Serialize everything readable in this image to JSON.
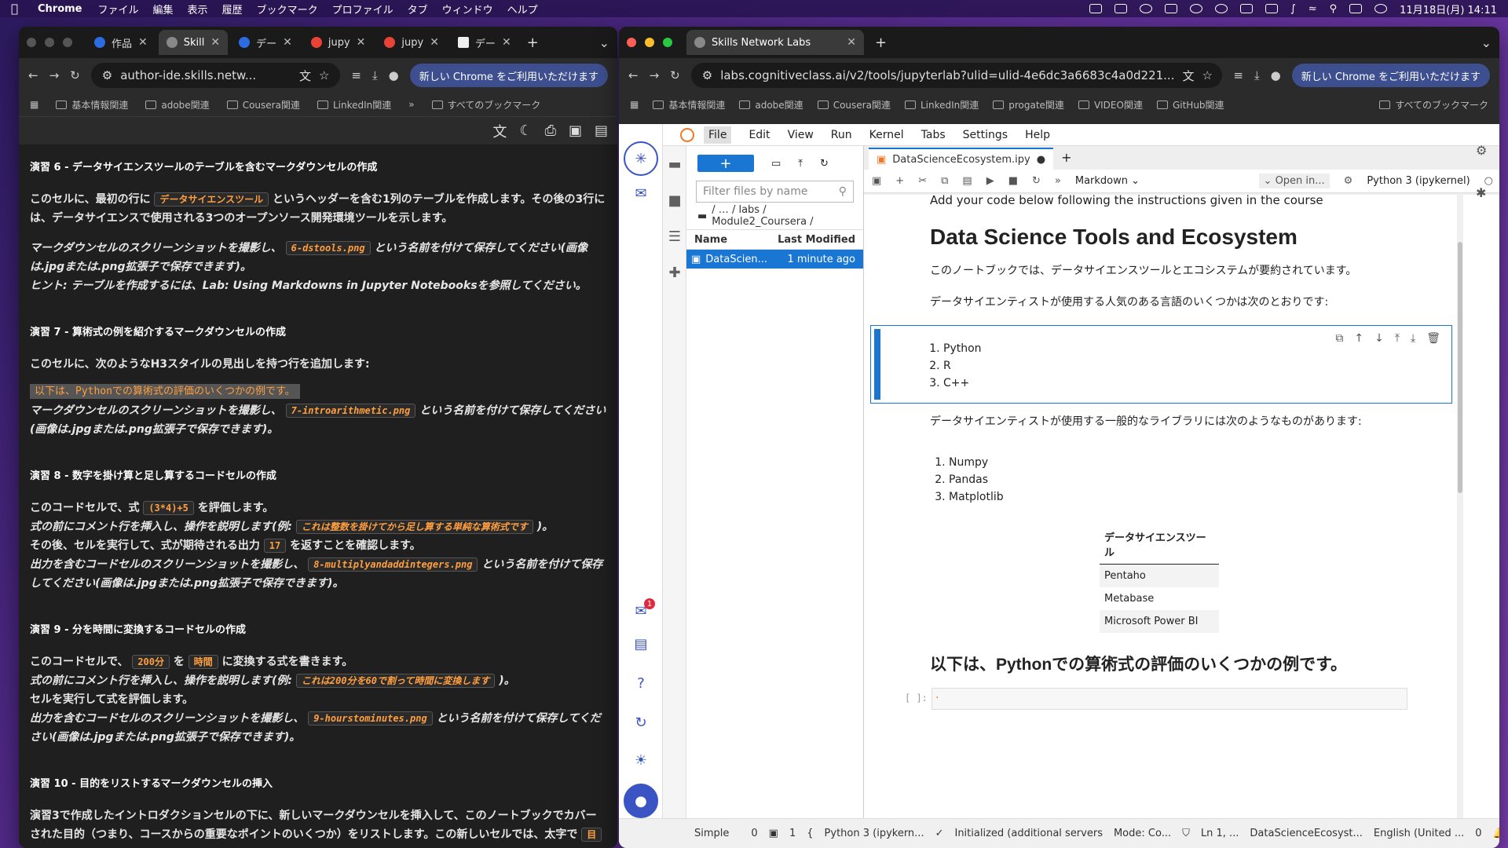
{
  "menubar": {
    "app": "Chrome",
    "items": [
      "ファイル",
      "編集",
      "表示",
      "履歴",
      "ブックマーク",
      "プロファイル",
      "タブ",
      "ウィンドウ",
      "ヘルプ"
    ],
    "datetime": "11月18日(月)  14:11"
  },
  "left": {
    "tabs": [
      {
        "label": "作品"
      },
      {
        "label": "Skill"
      },
      {
        "label": "デー"
      },
      {
        "label": "jupy"
      },
      {
        "label": "jupy"
      },
      {
        "label": "デー"
      }
    ],
    "url": "author-ide.skills.netw...",
    "update_label": "新しい Chrome をご利用いただけます",
    "bookmarks": [
      "基本情報関連",
      "adobe関連",
      "Cousera関連",
      "LinkedIn関連"
    ],
    "all_bookmarks": "すべてのブックマーク",
    "ex6": {
      "title": "演習 6 - データサイエンスツールのテーブルを含むマークダウンセルの作成",
      "t1": "このセルに、最初の行に",
      "c1": "データサイエンスツール",
      "t2": "というヘッダーを含む1列のテーブルを作成します。その後の3行には、データサイエンスで使用される3つのオープンソース開発環境ツールを示します。",
      "t3": "マークダウンセルのスクリーンショットを撮影し、",
      "c2": "6-dstools.png",
      "t4": "という名前を付けて保存してください(画像は.jpgまたは.png拡張子で保存できます)。",
      "t5": "ヒント: テーブルを作成するには、Lab: Using Markdowns in Jupyter Notebooksを参照してください。"
    },
    "ex7": {
      "title": "演習 7 - 算術式の例を紹介するマークダウンセルの作成",
      "t1": "このセルに、次のようなH3スタイルの見出しを持つ行を追加します:",
      "h": "以下は、Pythonでの算術式の評価のいくつかの例です。",
      "t2": "マークダウンセルのスクリーンショットを撮影し、",
      "c1": "7-introarithmetic.png",
      "t3": "という名前を付けて保存してください(画像は.jpgまたは.png拡張子で保存できます)。"
    },
    "ex8": {
      "title": "演習 8 - 数字を掛け算と足し算するコードセルの作成",
      "t1": "このコードセルで、式",
      "c1": "(3*4)+5",
      "t2": "を評価します。",
      "t3": "式の前にコメント行を挿入し、操作を説明します(例:",
      "c2": "これは整数を掛けてから足し算する単純な算術式です",
      "t4": ")。",
      "t5": "その後、セルを実行して、式が期待される出力",
      "c3": "17",
      "t6": "を返すことを確認します。",
      "t7": "出力を含むコードセルのスクリーンショットを撮影し、",
      "c4": "8-multiplyandaddintegers.png",
      "t8": "という名前を付けて保存してください(画像は.jpgまたは.png拡張子で保存できます)。"
    },
    "ex9": {
      "title": "演習 9 - 分を時間に変換するコードセルの作成",
      "t1": "このコードセルで、",
      "c1": "200分",
      "t2": "を",
      "c2": "時間",
      "t3": "に変換する式を書きます。",
      "t4": "式の前にコメント行を挿入し、操作を説明します(例:",
      "c3": "これは200分を60で割って時間に変換します",
      "t5": ")。",
      "t6": "セルを実行して式を評価します。",
      "t7": "出力を含むコードセルのスクリーンショットを撮影し、",
      "c4": "9-hourstominutes.png",
      "t8": "という名前を付けて保存してください(画像は.jpgまたは.png拡張子で保存できます)。"
    },
    "ex10": {
      "title": "演習 10 - 目的をリストするマークダウンセルの挿入",
      "t1": "演習3で作成したイントロダクションセルの下に、新しいマークダウンセルを挿入して、このノートブックでカバーされた目的（つまり、コースからの重要なポイントのいくつか）をリストします。この新しいセルでは、太字で",
      "c1": "目"
    }
  },
  "right": {
    "tab": "Skills Network Labs",
    "url": "labs.cognitiveclass.ai/v2/tools/jupyterlab?ulid=ulid-4e6dc3a6683c4a0d221...",
    "update_label": "新しい Chrome をご利用いただけます",
    "bookmarks": [
      "基本情報関連",
      "adobe関連",
      "Cousera関連",
      "LinkedIn関連",
      "progate関連",
      "VIDEO関連",
      "GitHub関連"
    ],
    "all_bookmarks": "すべてのブックマーク",
    "jmenu": [
      "File",
      "Edit",
      "View",
      "Run",
      "Kernel",
      "Tabs",
      "Settings",
      "Help"
    ],
    "filter_placeholder": "Filter files by name",
    "crumb": "/  …  / labs / Module2_Coursera /",
    "col_name": "Name",
    "col_modified": "Last Modified",
    "file_name": "DataScien...",
    "file_modified": "1 minute ago",
    "nb_tab": "DataScienceEcosystem.ipy",
    "cell_type": "Markdown",
    "open_in": "Open in...",
    "kernel": "Python 3 (ipykernel)",
    "nb": {
      "top_text": "Add your code below following the instructions given in the course",
      "h1": "Data Science Tools and Ecosystem",
      "intro": "このノートブックでは、データサイエンスツールとエコシステムが要約されています。",
      "lang_intro": "データサイエンティストが使用する人気のある言語のいくつかは次のとおりです:",
      "langs": [
        "Python",
        "R",
        "C++"
      ],
      "lib_intro": "データサイエンティストが使用する一般的なライブラリには次のようなものがあります:",
      "libs": [
        "Numpy",
        "Pandas",
        "Matplotlib"
      ],
      "table_header": "データサイエンスツール",
      "tools": [
        "Pentaho",
        "Metabase",
        "Microsoft Power BI"
      ],
      "h3": "以下は、Pythonでの算術式の評価のいくつかの例です。",
      "prompt": "[ ]:",
      "input": "."
    },
    "status": {
      "mode": "Simple",
      "n0": "0",
      "n1": "1",
      "kernel": "Python 3 (ipykern...",
      "init": "Initialized (additional servers",
      "mode2": "Mode: Co...",
      "ln": "Ln 1, ...",
      "file": "DataScienceEcosyst...",
      "lang": "English (United ...",
      "n2": "0"
    },
    "badge": "1"
  }
}
